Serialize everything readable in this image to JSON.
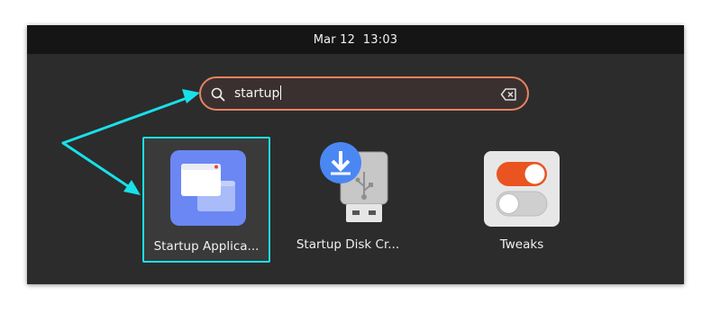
{
  "topbar": {
    "date": "Mar 12",
    "time": "13:03"
  },
  "search": {
    "value": "startup"
  },
  "results": [
    {
      "label": "Startup Applica...",
      "icon": "startup-applications-icon"
    },
    {
      "label": "Startup Disk Cr...",
      "icon": "startup-disk-creator-icon"
    },
    {
      "label": "Tweaks",
      "icon": "tweaks-icon"
    }
  ],
  "colors": {
    "search_border": "#e7845f",
    "highlight": "#19e0e8",
    "startup_app_icon": "#6a87f4",
    "download_badge": "#4b87f3",
    "toggle_on": "#e95420"
  }
}
